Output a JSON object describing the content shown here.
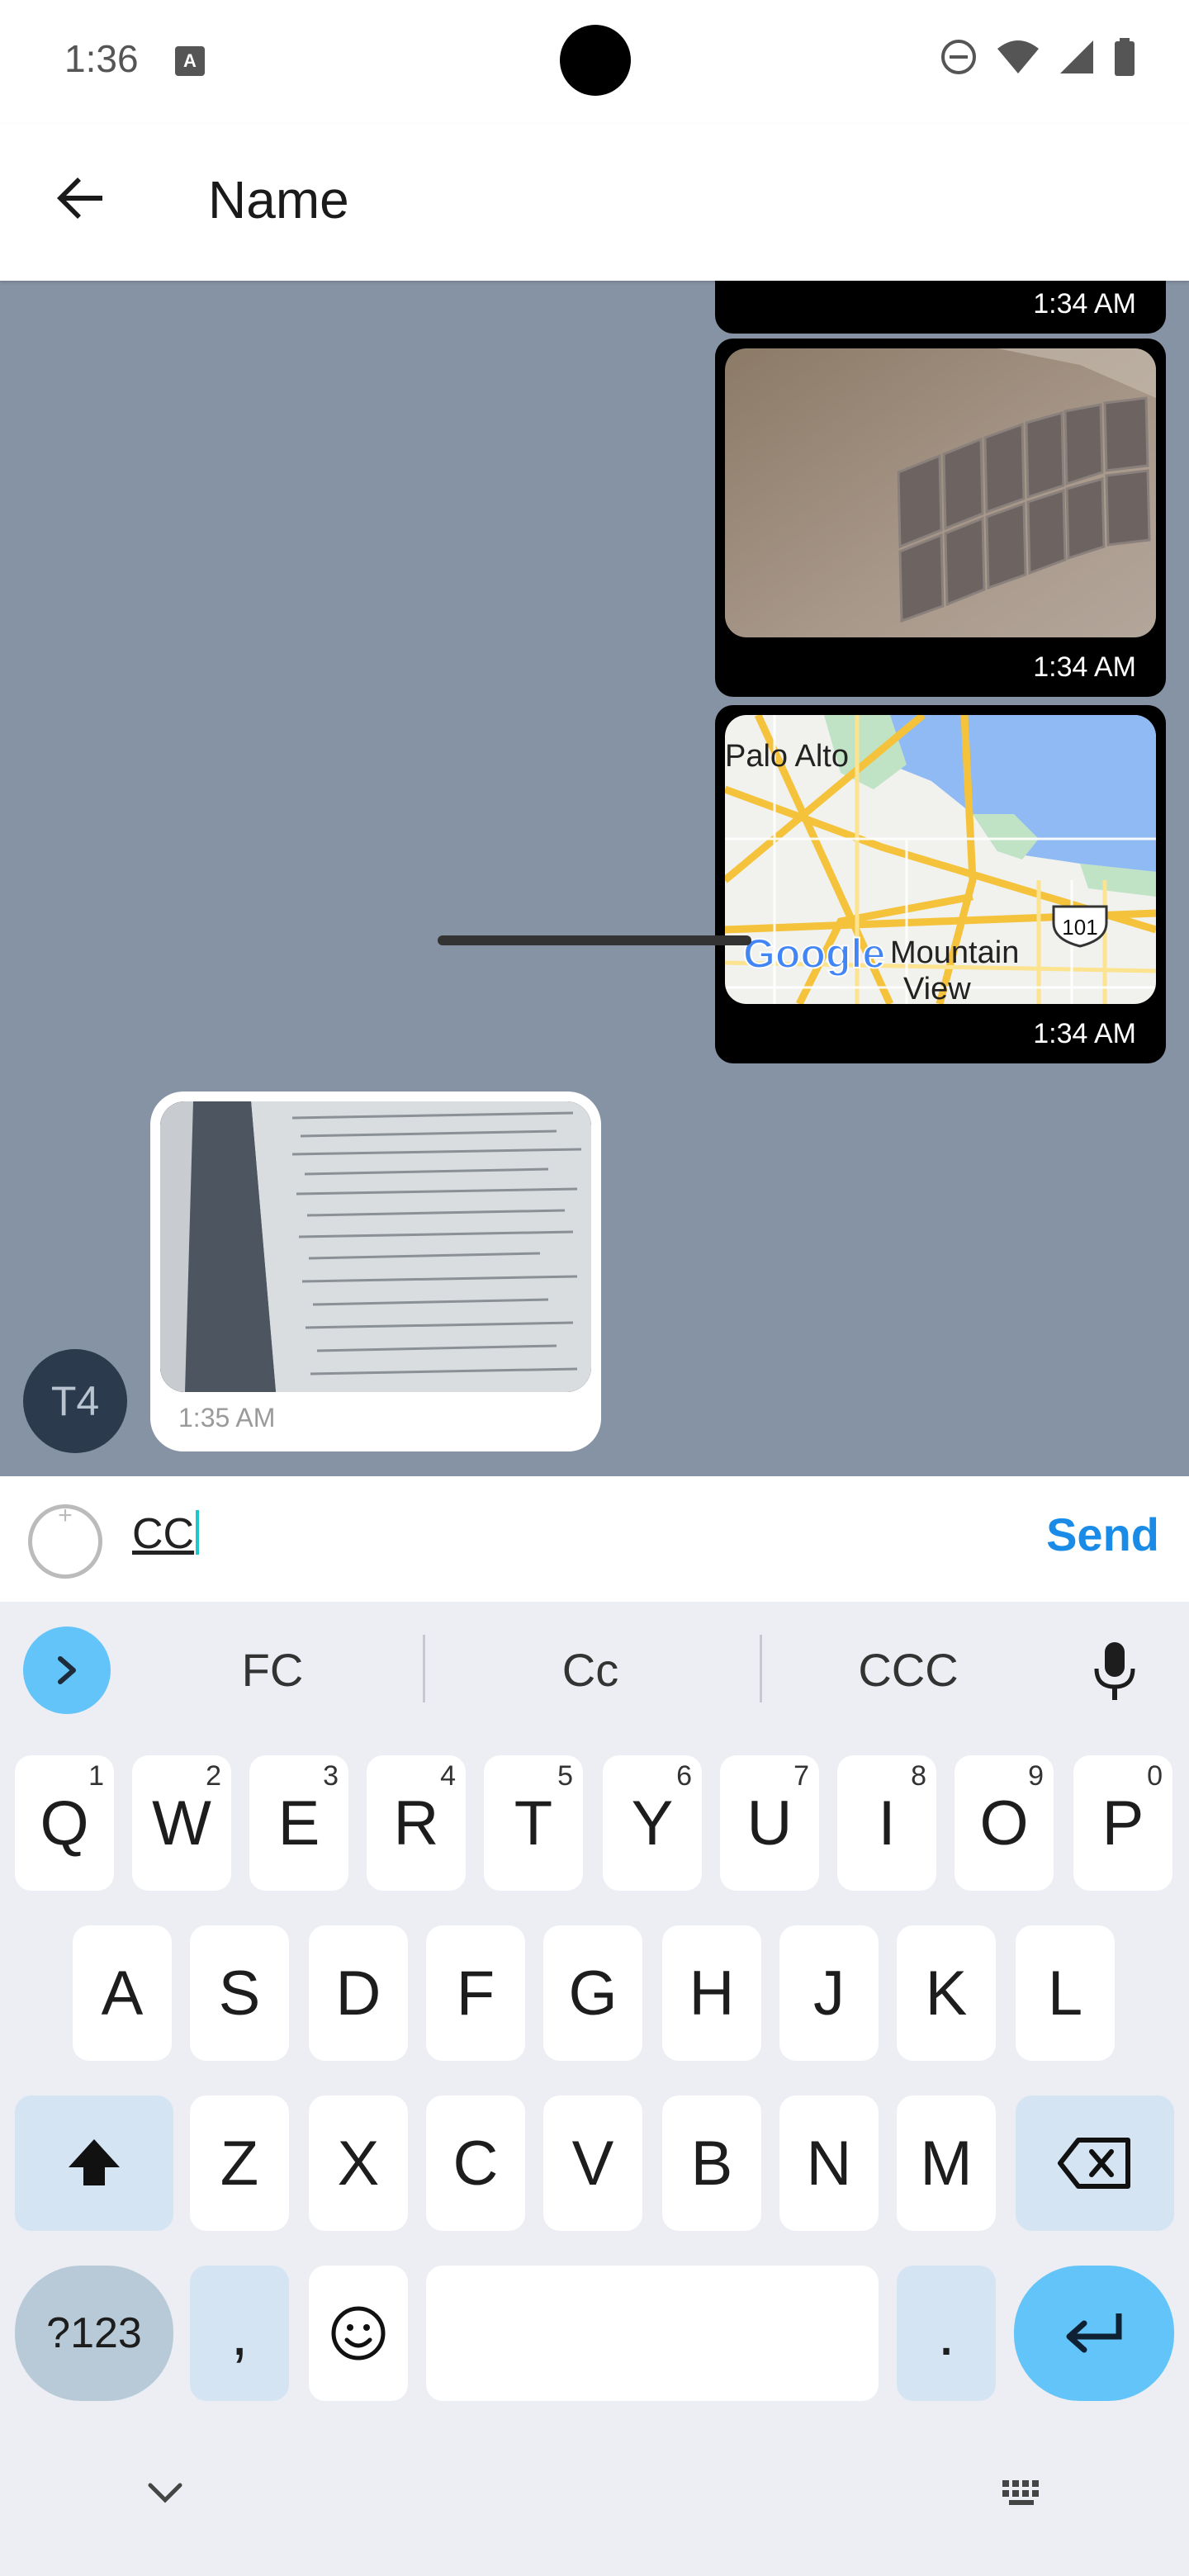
{
  "status_bar": {
    "time": "1:36",
    "notification_icon_letter": "A"
  },
  "app_bar": {
    "title": "Name"
  },
  "messages": [
    {
      "direction": "out",
      "type": "image",
      "time": "1:34 AM"
    },
    {
      "direction": "out",
      "type": "image",
      "time": "1:34 AM"
    },
    {
      "direction": "out",
      "type": "map",
      "time": "1:34 AM",
      "map_labels": {
        "city1": "Palo Alto",
        "city2a": "Mountain",
        "city2b": "View",
        "highway": "101",
        "logo": "Google"
      }
    },
    {
      "direction": "in",
      "type": "image",
      "time": "1:35 AM",
      "sender_initials": "T4"
    }
  ],
  "composer": {
    "value": "CC",
    "send_label": "Send"
  },
  "keyboard": {
    "suggestions": [
      "FC",
      "Cc",
      "CCC"
    ],
    "row1": [
      [
        "Q",
        "1"
      ],
      [
        "W",
        "2"
      ],
      [
        "E",
        "3"
      ],
      [
        "R",
        "4"
      ],
      [
        "T",
        "5"
      ],
      [
        "Y",
        "6"
      ],
      [
        "U",
        "7"
      ],
      [
        "I",
        "8"
      ],
      [
        "O",
        "9"
      ],
      [
        "P",
        "0"
      ]
    ],
    "row2": [
      "A",
      "S",
      "D",
      "F",
      "G",
      "H",
      "J",
      "K",
      "L"
    ],
    "row3": [
      "Z",
      "X",
      "C",
      "V",
      "B",
      "N",
      "M"
    ],
    "symbols_label": "?123",
    "comma": ",",
    "period": "."
  },
  "colors": {
    "chat_bg": "#8693a4",
    "accent": "#1a8ce8",
    "keyboard_bg": "#eceef3",
    "enter": "#62c4f8"
  }
}
